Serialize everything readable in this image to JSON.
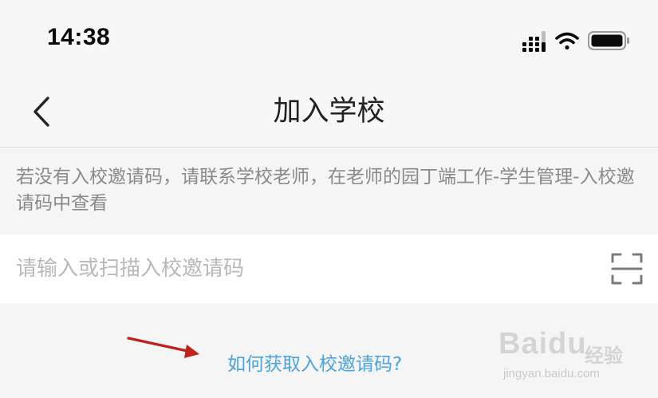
{
  "status_bar": {
    "time": "14:38",
    "icons": [
      "cellular-signal-icon",
      "wifi-icon",
      "battery-icon"
    ]
  },
  "nav": {
    "title": "加入学校",
    "back_icon": "chevron-left-icon"
  },
  "hint": {
    "text": "若没有入校邀请码，请联系学校老师，在老师的园丁端工作-学生管理-入校邀请码中查看"
  },
  "code_input": {
    "value": "",
    "placeholder": "请输入或扫描入校邀请码",
    "scan_icon": "scan-icon"
  },
  "help_link": {
    "label": "如何获取入校邀请码?"
  },
  "annotation": {
    "arrow_color": "#c0221b"
  },
  "watermark": {
    "brand": "Baidu",
    "sub": "经验",
    "url": "jingyan.baidu.com"
  },
  "colors": {
    "link": "#4aa3e0",
    "hint_text": "#8a8a8a",
    "placeholder": "#b8b8b8"
  }
}
